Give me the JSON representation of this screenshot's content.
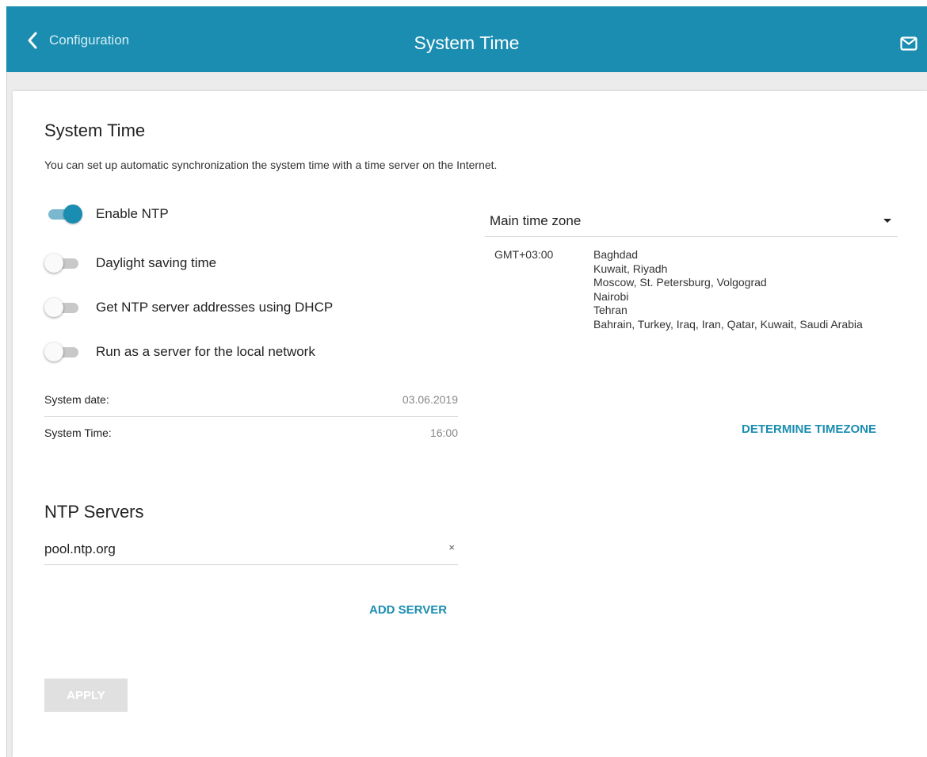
{
  "header": {
    "back_label": "Configuration",
    "title": "System Time"
  },
  "section": {
    "title": "System Time",
    "description": "You can set up automatic synchronization the system time with a time server on the Internet."
  },
  "toggles": [
    {
      "label": "Enable NTP",
      "on": true
    },
    {
      "label": "Daylight saving time",
      "on": false
    },
    {
      "label": "Get NTP server addresses using DHCP",
      "on": false
    },
    {
      "label": "Run as a server for the local network",
      "on": false
    }
  ],
  "system_info": {
    "date_label": "System date:",
    "date_value": "03.06.2019",
    "time_label": "System Time:",
    "time_value": "16:00"
  },
  "ntp": {
    "title": "NTP Servers",
    "server_value": "pool.ntp.org",
    "clear_symbol": "×",
    "add_label": "ADD SERVER"
  },
  "apply_label": "APPLY",
  "timezone": {
    "select_label": "Main time zone",
    "gmt": "GMT+03:00",
    "cities": [
      "Baghdad",
      "Kuwait, Riyadh",
      "Moscow, St. Petersburg, Volgograd",
      "Nairobi",
      "Tehran",
      "Bahrain, Turkey, Iraq, Iran, Qatar, Kuwait, Saudi Arabia"
    ],
    "determine_label": "DETERMINE TIMEZONE"
  },
  "colors": {
    "accent": "#1a8db0",
    "header_bg": "#1a8db0",
    "apply_disabled": "#e0e0e0"
  }
}
